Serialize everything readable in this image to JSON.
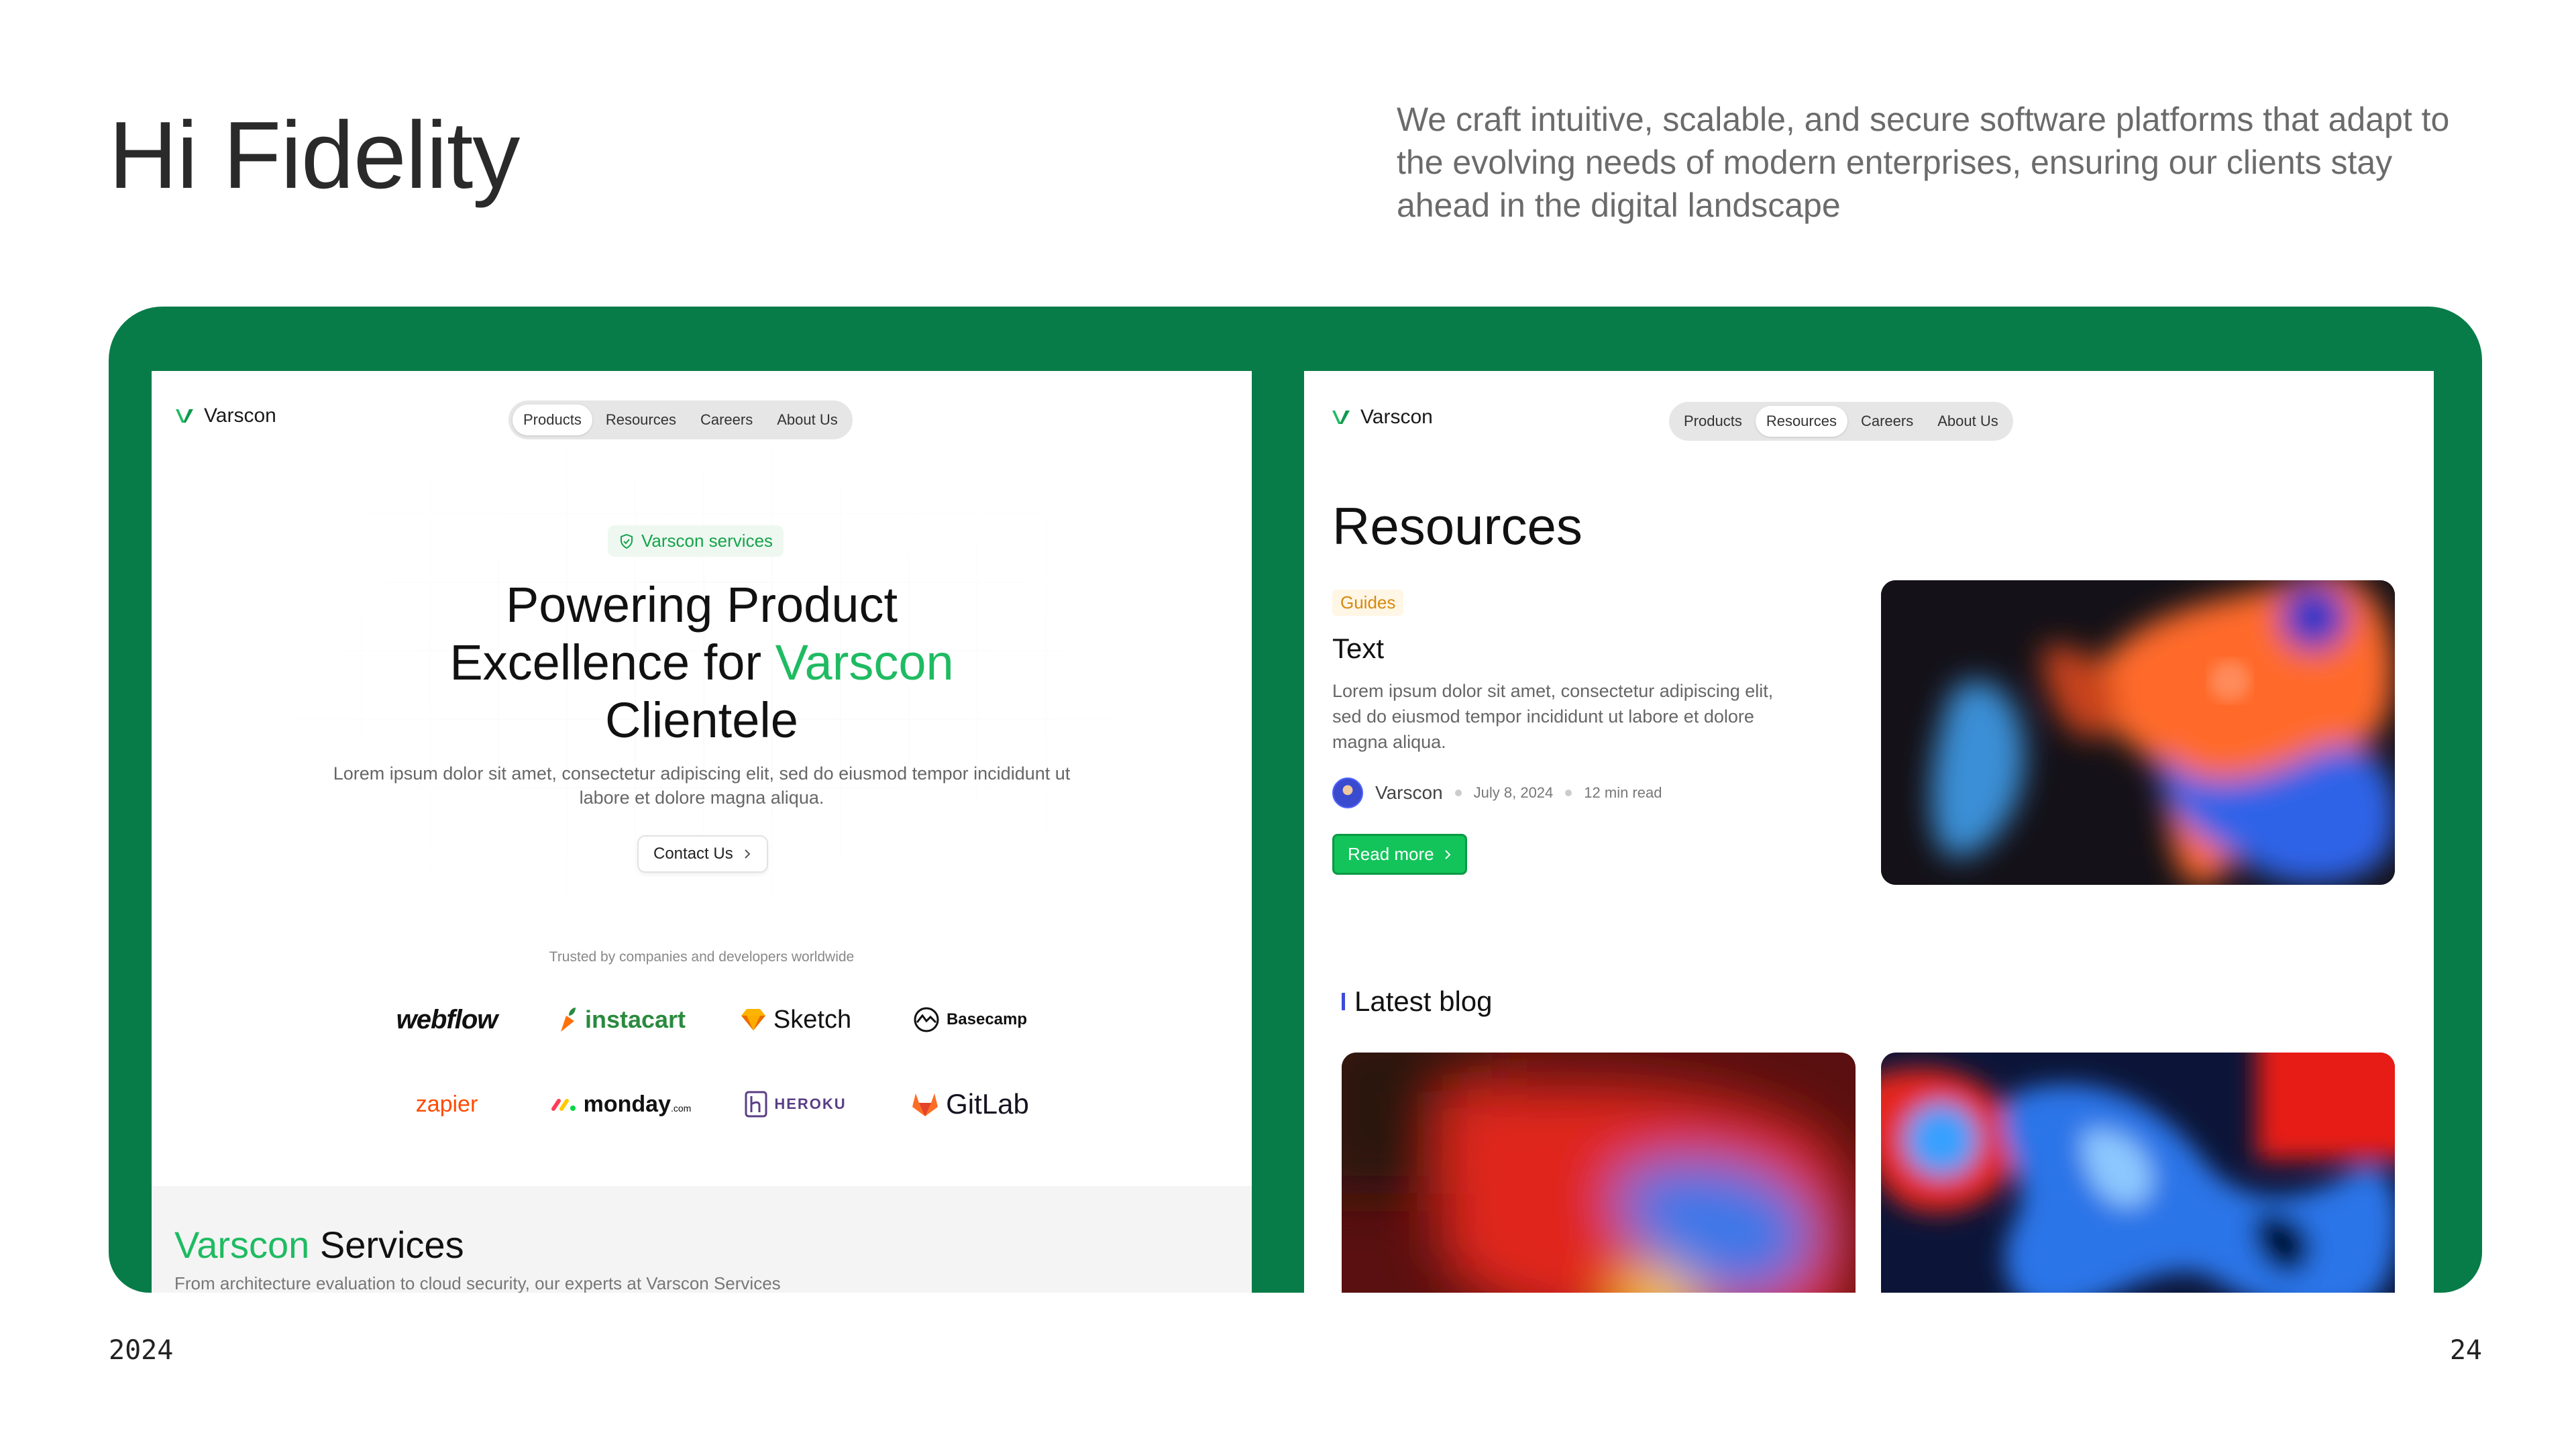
{
  "slide": {
    "title": "Hi Fidelity",
    "description": "We craft intuitive, scalable, and secure software platforms that adapt to the evolving needs of modern enterprises, ensuring our clients stay ahead in the digital landscape",
    "year": "2024",
    "page_number": "24"
  },
  "colors": {
    "frame_green": "#087c48",
    "accent_green": "#1fbb62",
    "button_green": "#12c45a",
    "tag_orange": "#d68910"
  },
  "left_screen": {
    "logo_text": "Varscon",
    "nav": [
      "Products",
      "Resources",
      "Careers",
      "About Us"
    ],
    "nav_active": "Products",
    "badge": "Varscon services",
    "hero_title_1": "Powering Product",
    "hero_title_2": "Excellence for ",
    "hero_title_accent": "Varscon",
    "hero_title_3": "Clientele",
    "hero_sub": "Lorem ipsum dolor sit amet, consectetur adipiscing elit, sed do eiusmod tempor incididunt ut labore et dolore magna aliqua.",
    "contact_button": "Contact Us",
    "trusted_text": "Trusted by companies and developers worldwide",
    "brands": {
      "webflow": "webflow",
      "instacart": "instacart",
      "sketch": "Sketch",
      "basecamp": "Basecamp",
      "zapier": "zapier",
      "monday": "monday",
      "monday_suffix": ".com",
      "heroku": "HEROKU",
      "gitlab": "GitLab"
    },
    "services_title_accent": "Varscon",
    "services_title_rest": " Services",
    "services_sub": "From architecture evaluation to cloud security, our experts at Varscon Services"
  },
  "right_screen": {
    "logo_text": "Varscon",
    "nav": [
      "Products",
      "Resources",
      "Careers",
      "About Us"
    ],
    "nav_active": "Resources",
    "page_title": "Resources",
    "featured": {
      "tag": "Guides",
      "title": "Text",
      "description": "Lorem ipsum dolor sit amet, consectetur adipiscing elit, sed do eiusmod tempor incididunt ut labore et dolore magna aliqua.",
      "author": "Varscon",
      "date": "July 8, 2024",
      "read_time": "12 min read",
      "button": "Read more"
    },
    "latest_blog": "Latest blog"
  }
}
